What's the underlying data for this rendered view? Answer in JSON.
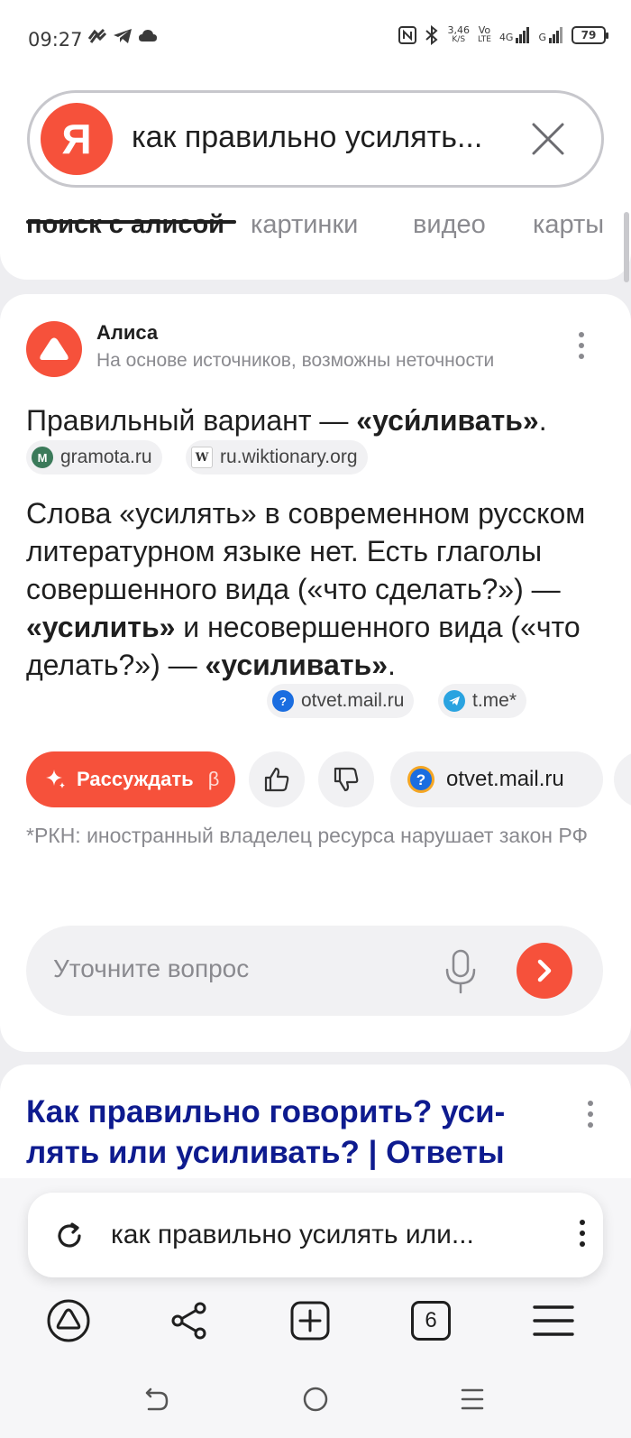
{
  "status_bar": {
    "time": "09:27",
    "net_speed_value": "3,46",
    "net_speed_unit": "K/S",
    "volte_top": "Vo",
    "volte_bottom": "LTE",
    "network": "4G",
    "network2": "G",
    "battery": "79"
  },
  "search": {
    "logo_letter": "Я",
    "query": "как правильно усилять..."
  },
  "tabs": [
    {
      "label": "поиск с алисой",
      "active": true
    },
    {
      "label": "картинки"
    },
    {
      "label": "видео"
    },
    {
      "label": "карты"
    }
  ],
  "alice": {
    "name": "Алиса",
    "subtitle": "На основе источников, возможны неточности",
    "answer_intro": "Правильный вариант — ",
    "answer_bold": "«уси́ливать»",
    "answer_end": ".",
    "sources_1": [
      {
        "label": "gramota.ru",
        "icon": "gramota-icon"
      },
      {
        "label": "ru.wiktionary.org",
        "icon": "wiktionary-icon"
      }
    ],
    "para_part1": "Слова «усилять» в современном русском литературном языке нет. Есть глаголы совершенного вида («что сделать?») — ",
    "para_bold1": "«усилить»",
    "para_part2": " и несовершенного вида («что делать?») — ",
    "para_bold2": "«усиливать»",
    "para_part3": ".",
    "sources_2": [
      {
        "label": "otvet.mail.ru",
        "icon": "otvet-mail-icon"
      },
      {
        "label": "t.me*",
        "icon": "telegram-icon"
      }
    ],
    "reason_button": "Рассуждать",
    "beta": "β",
    "source_pill": "otvet.mail.ru",
    "rkn_note": "*РКН: иностранный владелец ресурса нарушает закон РФ",
    "refine_placeholder": "Уточните вопрос"
  },
  "result": {
    "title": "Как правильно говорить? уси-лять или усиливать? | Ответы"
  },
  "url_bar": {
    "text": "как правильно усилять или..."
  },
  "browser_nav": {
    "tabs_count": "6"
  },
  "colors": {
    "accent": "#f6513b",
    "link": "#0e1b8f"
  }
}
